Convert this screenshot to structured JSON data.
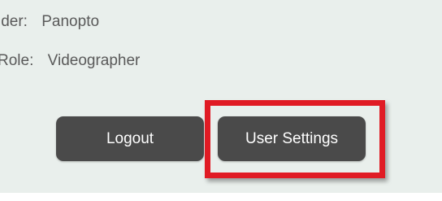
{
  "profile": {
    "provider_label": "ider:",
    "provider_value": "Panopto",
    "role_label": "Role:",
    "role_value": "Videographer"
  },
  "actions": {
    "logout_label": "Logout",
    "settings_label": "User Settings"
  },
  "annotation": {
    "highlight_color": "#e01b24"
  }
}
